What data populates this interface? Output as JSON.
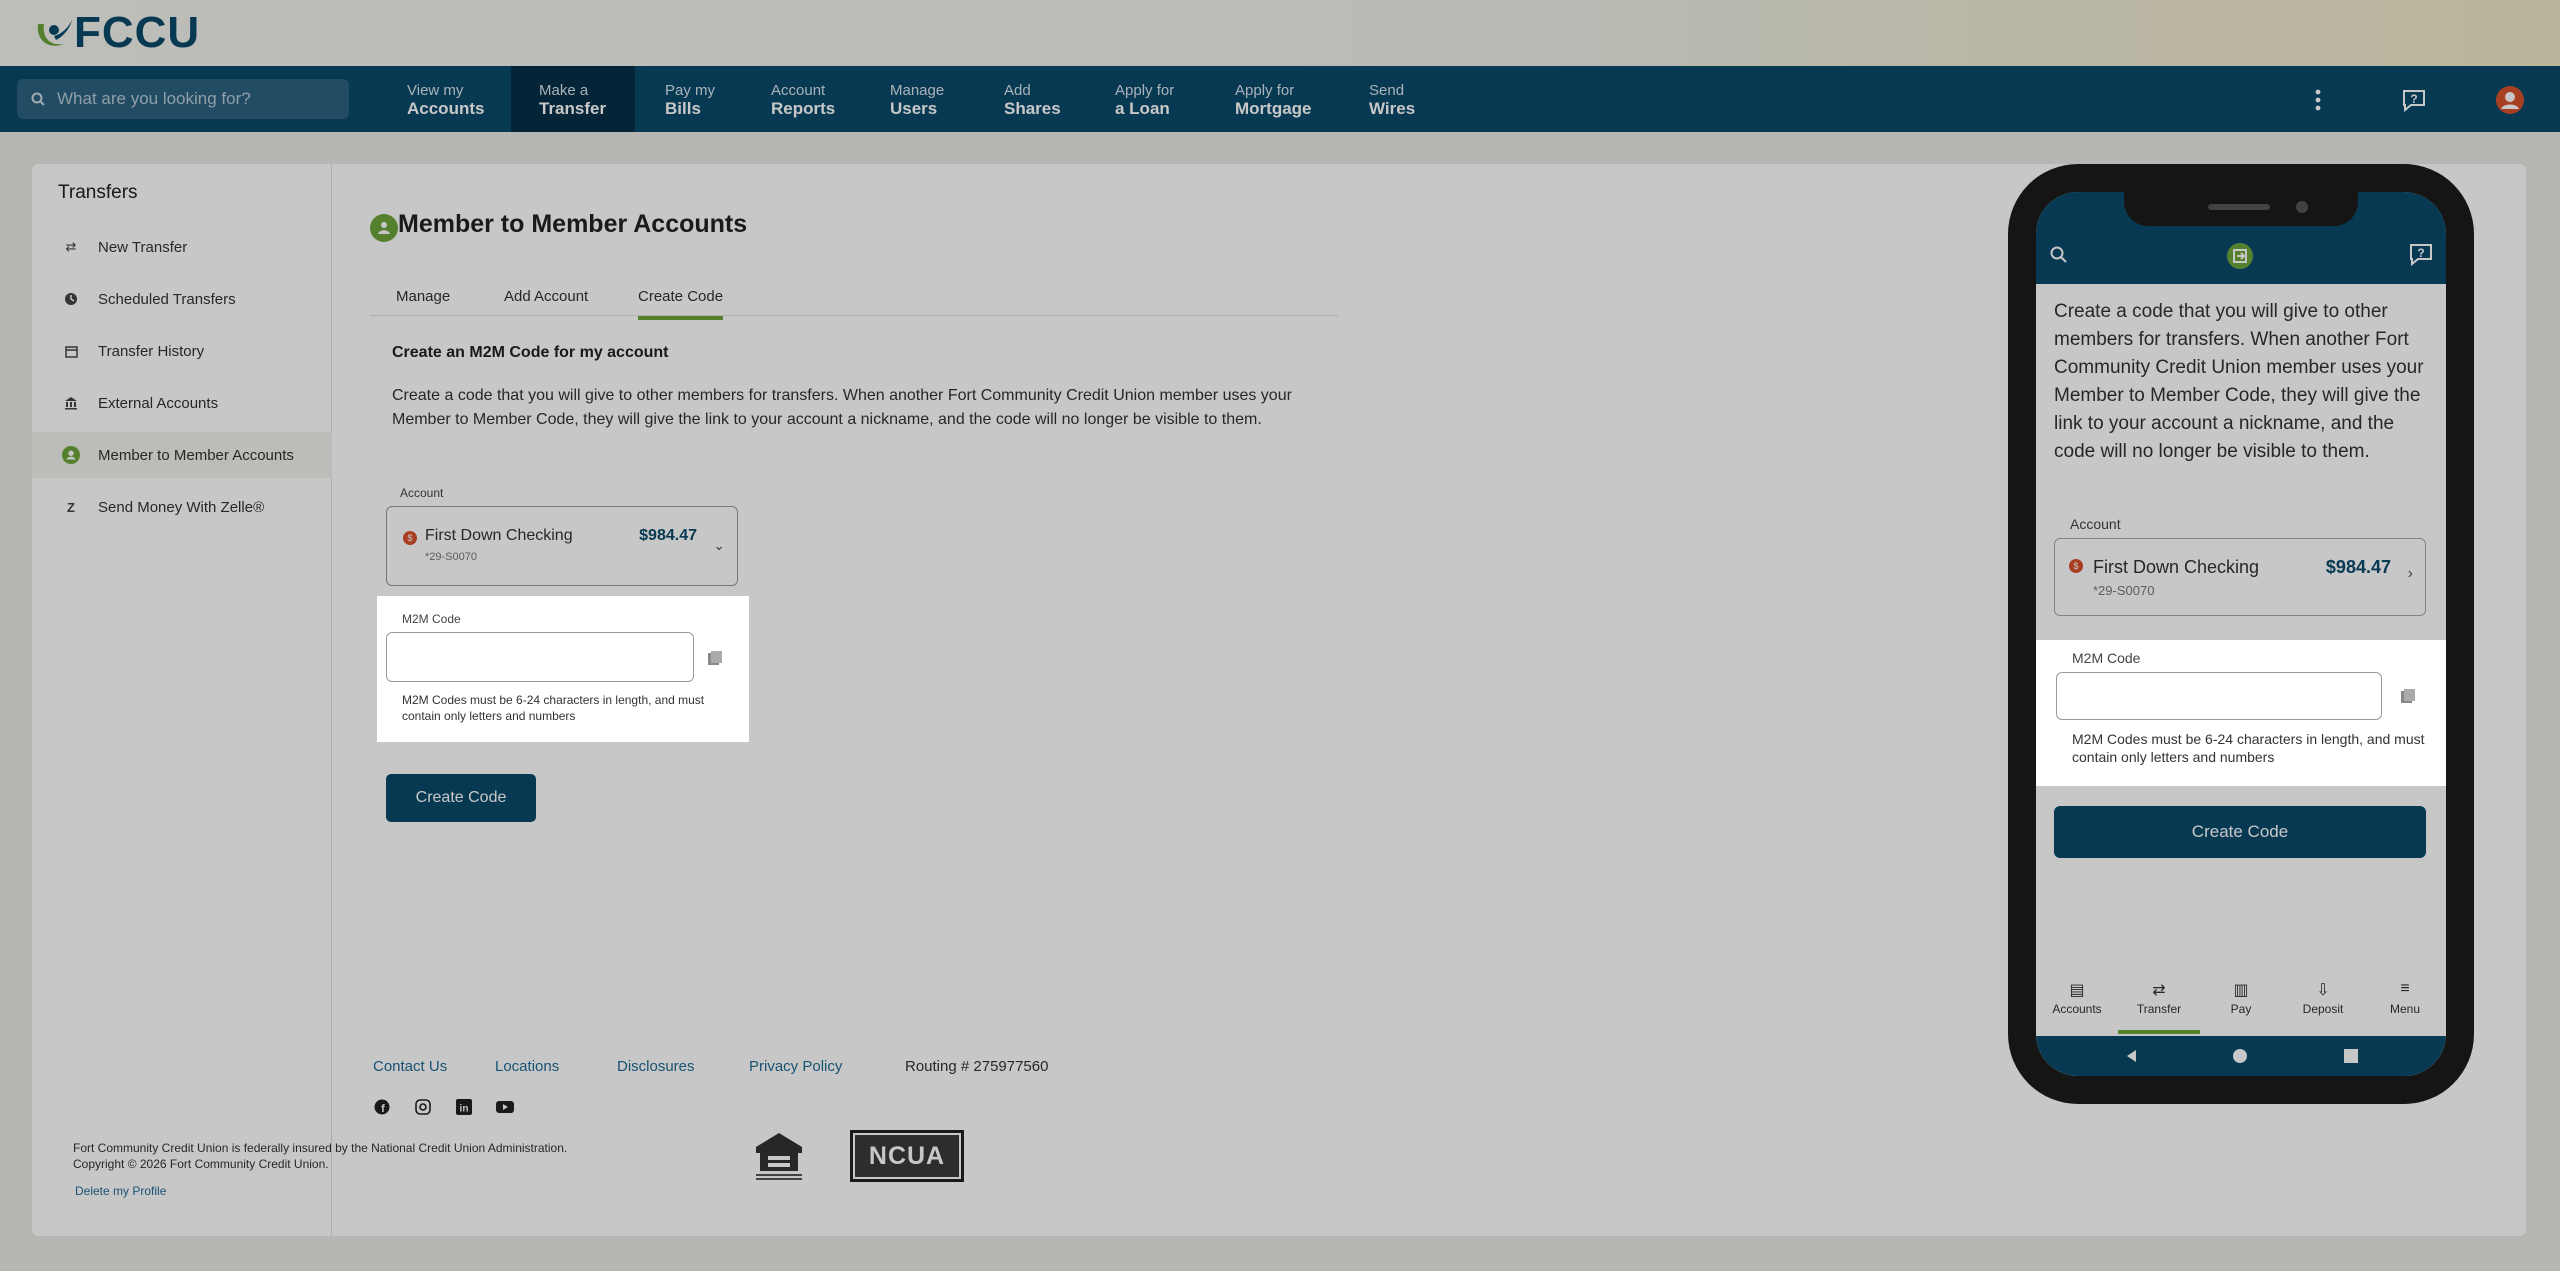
{
  "app": {
    "logo_text": "FCCU"
  },
  "search": {
    "placeholder": "What are you looking for?"
  },
  "nav": {
    "items": [
      {
        "l1": "View my",
        "l2": "Accounts"
      },
      {
        "l1": "Make a",
        "l2": "Transfer"
      },
      {
        "l1": "Pay my",
        "l2": "Bills"
      },
      {
        "l1": "Account",
        "l2": "Reports"
      },
      {
        "l1": "Manage",
        "l2": "Users"
      },
      {
        "l1": "Add",
        "l2": "Shares"
      },
      {
        "l1": "Apply for",
        "l2": "a Loan"
      },
      {
        "l1": "Apply for",
        "l2": "Mortgage"
      },
      {
        "l1": "Send",
        "l2": "Wires"
      }
    ],
    "active_index": 1,
    "icons": [
      "more-icon",
      "help-icon",
      "profile-icon"
    ]
  },
  "sidebar": {
    "title": "Transfers",
    "items": [
      {
        "label": "New Transfer",
        "icon": "arrows-icon"
      },
      {
        "label": "Scheduled Transfers",
        "icon": "clock-icon"
      },
      {
        "label": "Transfer History",
        "icon": "calendar-icon"
      },
      {
        "label": "External Accounts",
        "icon": "bank-icon"
      },
      {
        "label": "Member to Member Accounts",
        "icon": "member-icon"
      },
      {
        "label": "Send Money With Zelle®",
        "icon": "zelle-icon"
      }
    ],
    "active_index": 4
  },
  "main": {
    "title": "Member to Member Accounts",
    "tabs": [
      "Manage",
      "Add Account",
      "Create Code"
    ],
    "active_tab": 2,
    "section_title": "Create an M2M Code for my account",
    "description": "Create a code that you will give to other members for transfers. When another Fort Community Credit Union member uses your Member to Member Code, they will give the link to your account a nickname, and the code will no longer be visible to them.",
    "account_label": "Account",
    "account": {
      "name": "First Down Checking",
      "number": "*29-S0070",
      "balance": "$984.47"
    },
    "m2m_label": "M2M Code",
    "m2m_value": "",
    "m2m_hint": "M2M Codes must be 6-24 characters in length, and must contain only letters and numbers",
    "create_button": "Create Code"
  },
  "footer": {
    "links": [
      "Contact Us",
      "Locations",
      "Disclosures",
      "Privacy Policy"
    ],
    "routing": "Routing # 275977560",
    "social": [
      "facebook-icon",
      "instagram-icon",
      "linkedin-icon",
      "youtube-icon"
    ],
    "legal_line1": "Fort Community Credit Union is federally insured by the National Credit Union Administration.",
    "legal_line2": "Copyright © 2026 Fort Community Credit Union.",
    "delete_profile": "Delete my Profile",
    "ncua_text": "NCUA"
  },
  "phone": {
    "description": "Create a code that you will give to other members for transfers. When another Fort Community Credit Union member uses your Member to Member Code, they will give the link to your account a nickname, and the code will no longer be visible to them.",
    "account_label": "Account",
    "account": {
      "name": "First Down Checking",
      "number": "*29-S0070",
      "balance": "$984.47"
    },
    "m2m_label": "M2M Code",
    "m2m_hint": "M2M Codes must be 6-24 characters in length, and must contain only letters and numbers",
    "create_button": "Create Code",
    "tabs": [
      "Accounts",
      "Transfer",
      "Pay",
      "Deposit",
      "Menu"
    ],
    "active_tab": 1
  },
  "colors": {
    "brand": "#0b4a6b",
    "accent": "#6ea43a"
  }
}
